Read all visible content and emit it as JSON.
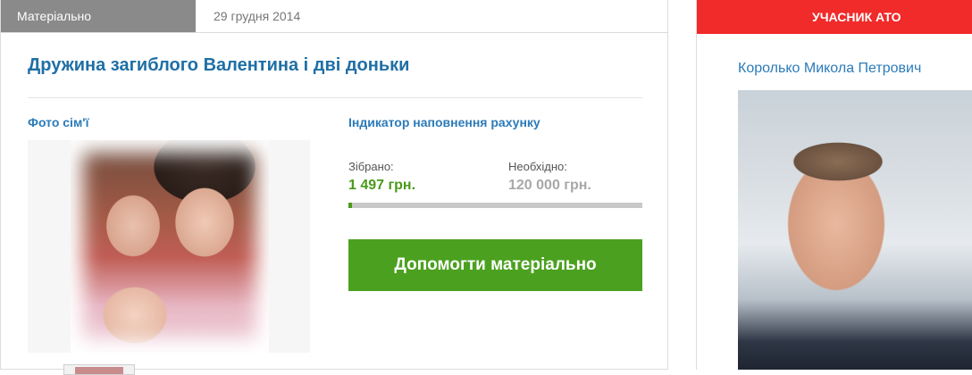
{
  "header": {
    "category": "Матеріально",
    "date": "29 грудня 2014"
  },
  "card": {
    "title": "Дружина загиблого Валентина і дві доньки",
    "photo_label": "Фото сім'ї",
    "indicator_label": "Індикатор наповнення рахунку",
    "collected_label": "Зібрано:",
    "collected_value": "1 497 грн.",
    "needed_label": "Необхідно:",
    "needed_value": "120 000 грн.",
    "progress_fraction": 0.0125,
    "help_button": "Допомогти матеріально"
  },
  "side": {
    "banner": "УЧАСНИК АТО",
    "name": "Королько Микола Петрович"
  },
  "colors": {
    "accent_blue": "#2b7bb9",
    "success_green": "#4ba11f",
    "banner_red": "#f12a2a",
    "category_gray": "#8a8a8a"
  }
}
